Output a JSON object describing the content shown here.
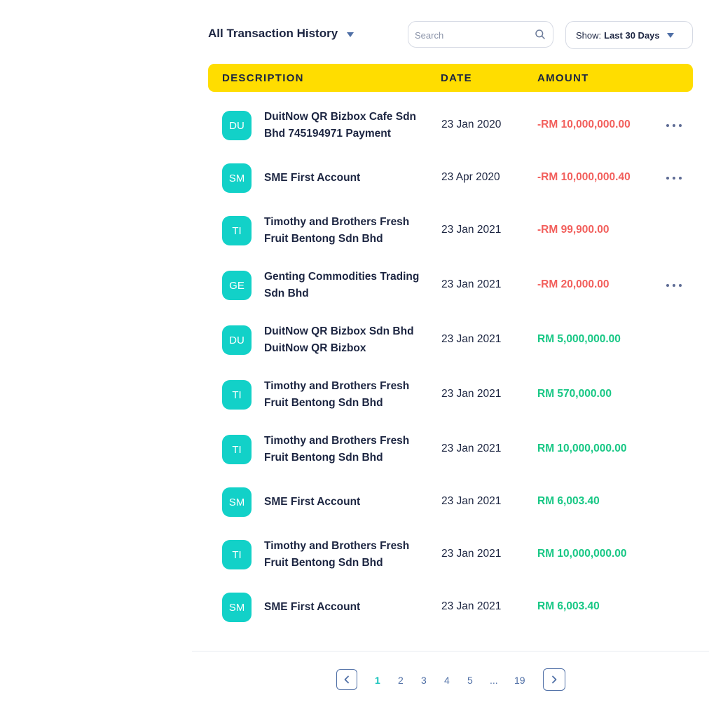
{
  "header": {
    "title": "All Transaction History",
    "search_placeholder": "Search",
    "show_label": "Show:",
    "show_value": "Last 30 Days"
  },
  "table": {
    "columns": [
      "DESCRIPTION",
      "DATE",
      "AMOUNT"
    ],
    "rows": [
      {
        "initials": "DU",
        "description": "DuitNow QR Bizbox Cafe Sdn Bhd 745194971 Payment",
        "date": "23 Jan 2020",
        "amount": "-RM 10,000,000.00",
        "type": "debit",
        "menu": true
      },
      {
        "initials": "SM",
        "description": "SME First Account",
        "date": "23 Apr 2020",
        "amount": "-RM 10,000,000.40",
        "type": "debit",
        "menu": true
      },
      {
        "initials": "TI",
        "description": "Timothy and Brothers Fresh Fruit Bentong Sdn Bhd",
        "date": "23 Jan 2021",
        "amount": "-RM 99,900.00",
        "type": "debit",
        "menu": false
      },
      {
        "initials": "GE",
        "description": "Genting Commodities Trading Sdn Bhd",
        "date": "23 Jan 2021",
        "amount": "-RM 20,000.00",
        "type": "debit",
        "menu": true
      },
      {
        "initials": "DU",
        "description": "DuitNow QR Bizbox Sdn Bhd DuitNow QR Bizbox",
        "date": "23 Jan 2021",
        "amount": "RM 5,000,000.00",
        "type": "credit",
        "menu": false
      },
      {
        "initials": "TI",
        "description": "Timothy and Brothers Fresh Fruit Bentong Sdn Bhd",
        "date": "23 Jan 2021",
        "amount": "RM 570,000.00",
        "type": "credit",
        "menu": false
      },
      {
        "initials": "TI",
        "description": "Timothy and Brothers Fresh Fruit Bentong Sdn Bhd",
        "date": "23 Jan 2021",
        "amount": "RM 10,000,000.00",
        "type": "credit",
        "menu": false
      },
      {
        "initials": "SM",
        "description": "SME First Account",
        "date": "23 Jan 2021",
        "amount": "RM 6,003.40",
        "type": "credit",
        "menu": false
      },
      {
        "initials": "TI",
        "description": "Timothy and Brothers Fresh Fruit Bentong Sdn Bhd",
        "date": "23 Jan 2021",
        "amount": "RM 10,000,000.00",
        "type": "credit",
        "menu": false
      },
      {
        "initials": "SM",
        "description": "SME First Account",
        "date": "23 Jan 2021",
        "amount": "RM 6,003.40",
        "type": "credit",
        "menu": false
      }
    ]
  },
  "pagination": {
    "pages": [
      "1",
      "2",
      "3",
      "4",
      "5",
      "...",
      "19"
    ],
    "current": "1",
    "prev_icon": "chevron-left-icon",
    "next_icon": "chevron-right-icon"
  },
  "colors": {
    "accent_yellow": "#ffdd00",
    "avatar_teal": "#12d1c8",
    "debit_red": "#f25f5c",
    "credit_green": "#16c784",
    "text_navy": "#1c2541"
  }
}
